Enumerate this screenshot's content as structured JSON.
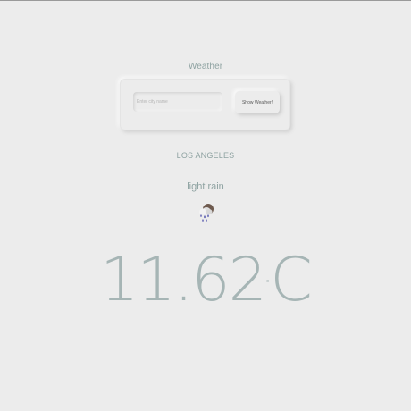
{
  "app": {
    "title": "Weather"
  },
  "search": {
    "placeholder": "Enter city name",
    "value": "",
    "button_label": "Show Weather!"
  },
  "result": {
    "city": "LOS ANGELES",
    "description": "light rain",
    "icon": "rain-cloud-icon",
    "temperature": "11.62",
    "degree_symbol": "°",
    "unit": "C"
  },
  "colors": {
    "background": "#ececec",
    "text_accent": "#8fa3a2",
    "temperature": "#a6b5b5",
    "rain_drops": "#2a2e9c"
  }
}
